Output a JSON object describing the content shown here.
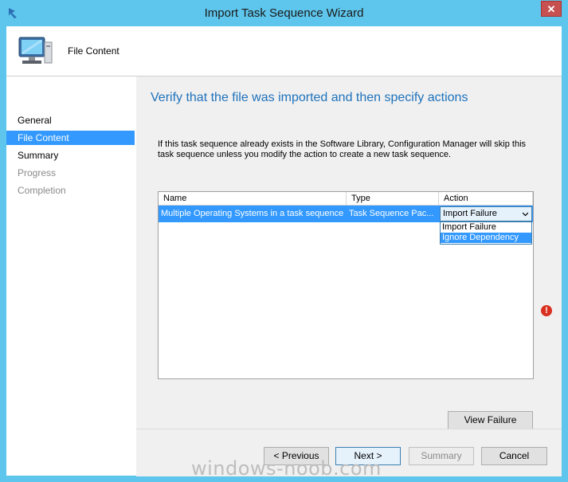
{
  "window": {
    "title": "Import Task Sequence Wizard",
    "close_glyph": "✕"
  },
  "header": {
    "icon": "computer-icon",
    "title": "File Content"
  },
  "nav": {
    "items": [
      {
        "label": "General",
        "state": "normal"
      },
      {
        "label": "File Content",
        "state": "selected"
      },
      {
        "label": "Summary",
        "state": "normal"
      },
      {
        "label": "Progress",
        "state": "disabled"
      },
      {
        "label": "Completion",
        "state": "disabled"
      }
    ]
  },
  "content": {
    "heading": "Verify that the file was imported and then specify actions",
    "description": "If this task sequence already exists in the Software Library, Configuration Manager will skip this task sequence unless you modify the action to create a new task sequence.",
    "grid": {
      "columns": [
        "Name",
        "Type",
        "Action"
      ],
      "rows": [
        {
          "name": "Multiple Operating Systems in a task sequence",
          "type": "Task Sequence Pac...",
          "action": "Import Failure"
        }
      ],
      "dropdown_options": [
        "Import Failure",
        "Ignore Dependency"
      ],
      "highlighted_option": "Ignore Dependency"
    },
    "error_glyph": "!",
    "view_failure_label": "View Failure"
  },
  "footer": {
    "previous_label": "< Previous",
    "next_label": "Next >",
    "summary_label": "Summary",
    "cancel_label": "Cancel"
  },
  "watermark": "windows-noob.com",
  "colors": {
    "frame": "#5ec6ec",
    "selection": "#3399ff",
    "heading": "#1e72bc",
    "error": "#d9301f"
  }
}
